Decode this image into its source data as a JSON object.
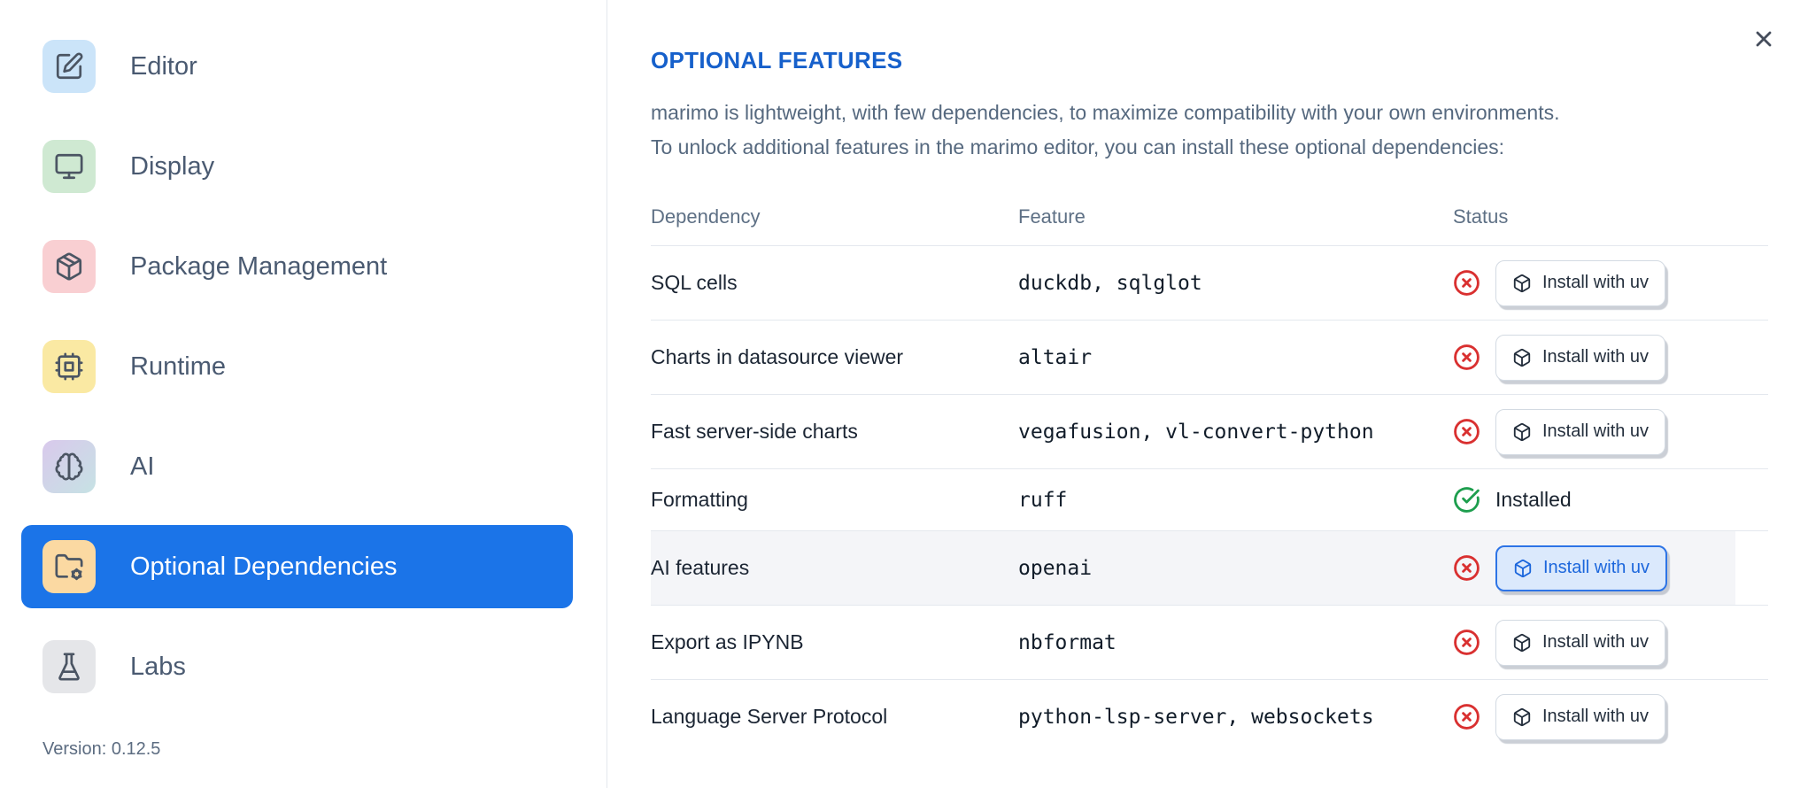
{
  "dialog": {
    "title": "OPTIONAL FEATURES",
    "description": [
      "marimo is lightweight, with few dependencies, to maximize compatibility with your own environments.",
      "To unlock additional features in the marimo editor, you can install these optional dependencies:"
    ],
    "close_icon": "close-icon"
  },
  "sidebar": {
    "version": "Version: 0.12.5",
    "items": [
      {
        "label": "Editor",
        "icon": "square-pen-icon",
        "icon_bg": "#cbe4f9",
        "selected": false
      },
      {
        "label": "Display",
        "icon": "monitor-icon",
        "icon_bg": "#cfe9d2",
        "selected": false
      },
      {
        "label": "Package Management",
        "icon": "package-icon",
        "icon_bg": "#f9cfd2",
        "selected": false
      },
      {
        "label": "Runtime",
        "icon": "cpu-icon",
        "icon_bg": "#fae9a3",
        "selected": false
      },
      {
        "label": "AI",
        "icon": "brain-icon",
        "icon_bg": "linear-gradient(135deg,#d9c9ec,#c6e2e4)",
        "selected": false
      },
      {
        "label": "Optional Dependencies",
        "icon": "folder-cog-icon",
        "icon_bg": "#fbd9a2",
        "selected": true
      },
      {
        "label": "Labs",
        "icon": "flask-icon",
        "icon_bg": "#e5e6e9",
        "selected": false
      }
    ]
  },
  "table": {
    "columns": [
      "Dependency",
      "Feature",
      "Status"
    ],
    "install_button_label": "Install with uv",
    "installed_label": "Installed",
    "button_icon": "box-icon",
    "status_error_icon": "circle-x-icon",
    "status_success_icon": "circle-check-icon",
    "rows": [
      {
        "dependency": "SQL cells",
        "feature": "duckdb, sqlglot",
        "installed": false,
        "highlighted": false
      },
      {
        "dependency": "Charts in datasource viewer",
        "feature": "altair",
        "installed": false,
        "highlighted": false
      },
      {
        "dependency": "Fast server-side charts",
        "feature": "vegafusion, vl-convert-python",
        "installed": false,
        "highlighted": false
      },
      {
        "dependency": "Formatting",
        "feature": "ruff",
        "installed": true,
        "highlighted": false
      },
      {
        "dependency": "AI features",
        "feature": "openai",
        "installed": false,
        "highlighted": true
      },
      {
        "dependency": "Export as IPYNB",
        "feature": "nbformat",
        "installed": false,
        "highlighted": false
      },
      {
        "dependency": "Language Server Protocol",
        "feature": "python-lsp-server, websockets",
        "installed": false,
        "highlighted": false
      }
    ]
  },
  "colors": {
    "accent_blue": "#1b74e8",
    "title_blue": "#1660cb",
    "error_red": "#d93030",
    "success_green": "#1e9e4e",
    "highlight_button_bg": "#dbe9fc",
    "highlight_button_border": "#2d74e6",
    "highlight_button_text": "#1b66dc"
  }
}
